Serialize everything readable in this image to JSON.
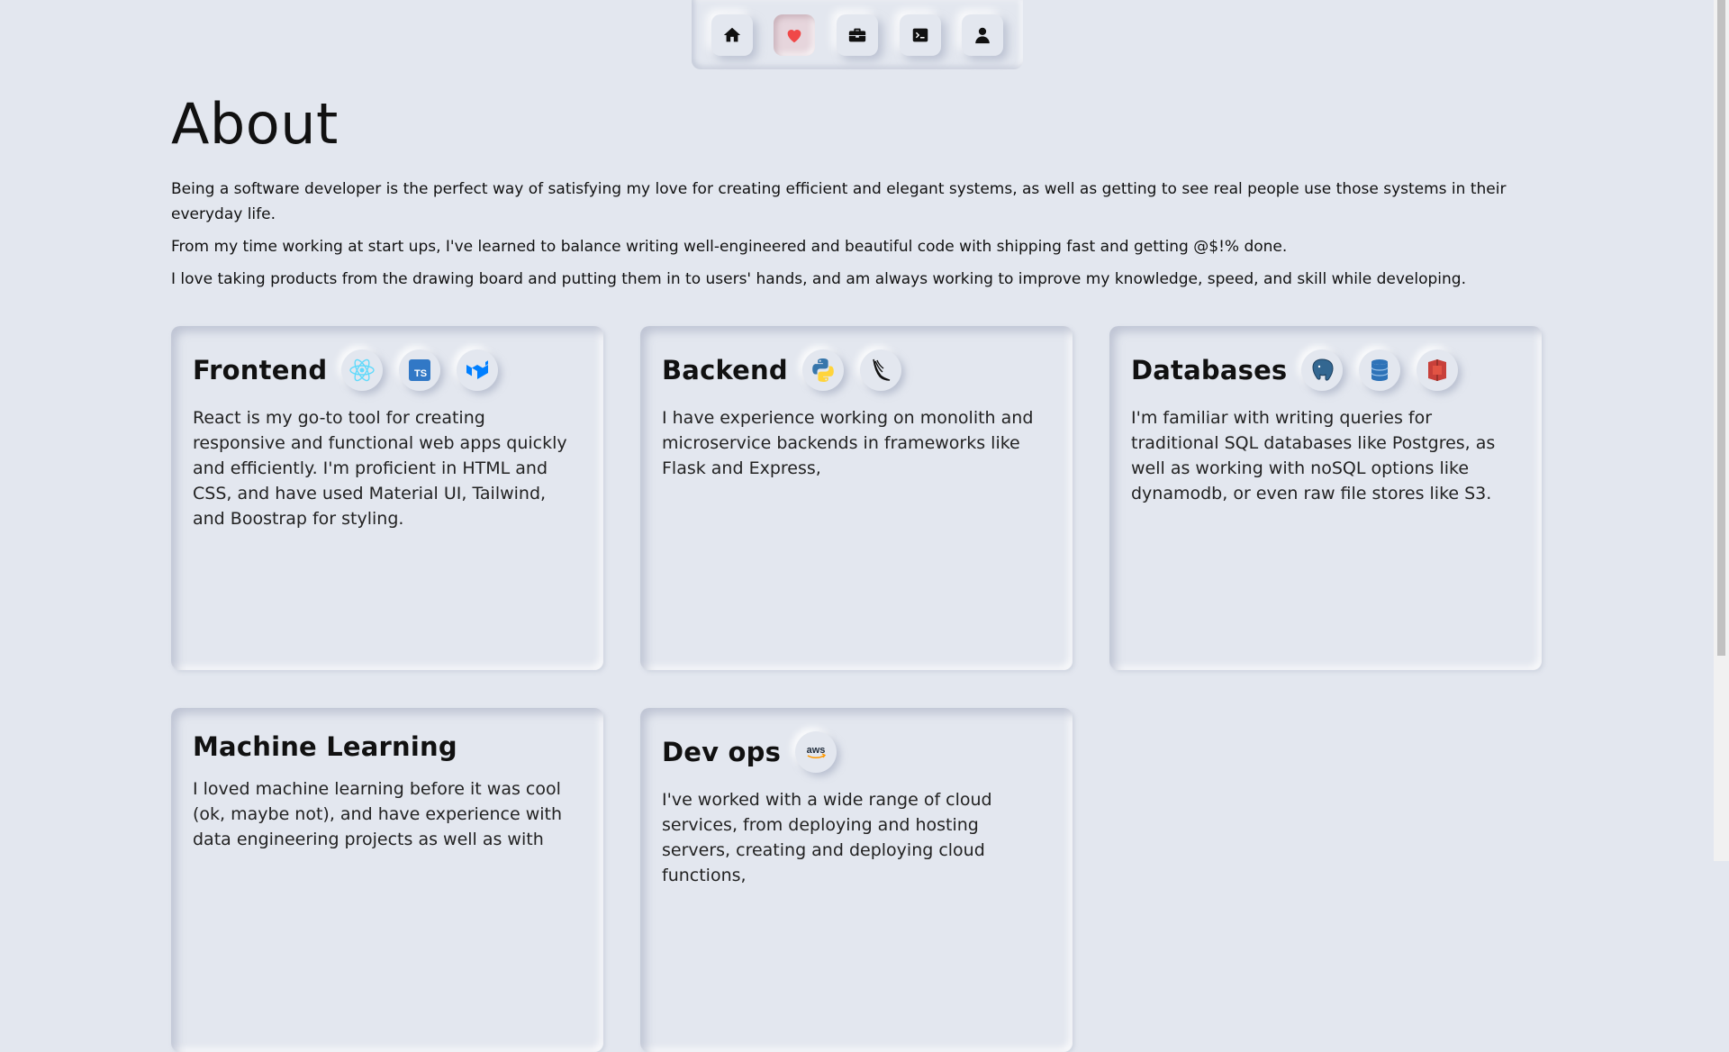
{
  "nav": {
    "items": [
      {
        "icon": "home-icon",
        "label": "Home"
      },
      {
        "icon": "heart-icon",
        "label": "About"
      },
      {
        "icon": "briefcase-icon",
        "label": "Work"
      },
      {
        "icon": "terminal-icon",
        "label": "Projects"
      },
      {
        "icon": "person-icon",
        "label": "Contact"
      }
    ],
    "active_index": 1,
    "active_color": "#f04848"
  },
  "about": {
    "title": "About",
    "paragraphs": [
      "Being a software developer is the perfect way of satisfying my love for creating efficient and elegant systems, as well as getting to see real people use those systems in their everyday life.",
      "From my time working at start ups, I've learned to balance writing well-engineered and beautiful code with shipping fast and getting @$!% done.",
      "I love taking products from the drawing board and putting them in to users' hands, and am always working to improve my knowledge, speed, and skill while developing."
    ]
  },
  "cards": [
    {
      "title": "Frontend",
      "icons": [
        "react-icon",
        "typescript-icon",
        "material-ui-icon"
      ],
      "text": "React is my go-to tool for creating responsive and functional web apps quickly and efficiently. I'm proficient in HTML and CSS, and have used Material UI, Tailwind, and Boostrap for styling."
    },
    {
      "title": "Backend",
      "icons": [
        "python-icon",
        "flask-icon"
      ],
      "text": "I have experience working on monolith and microservice backends in frameworks like Flask and Express,"
    },
    {
      "title": "Databases",
      "icons": [
        "postgres-icon",
        "dynamodb-icon",
        "s3-icon"
      ],
      "text": "I'm familiar with writing queries for traditional SQL databases like Postgres, as well as working with noSQL options like dynamodb, or even raw file stores like S3."
    },
    {
      "title": "Machine Learning",
      "icons": [],
      "text": "I loved machine learning before it was cool (ok, maybe not), and have experience with data engineering projects as well as with"
    },
    {
      "title": "Dev ops",
      "icons": [
        "aws-icon"
      ],
      "text": "I've worked with a wide range of cloud services, from deploying and hosting servers, creating and deploying cloud functions,"
    }
  ],
  "aws_label": "aws",
  "ts_label": "TS"
}
